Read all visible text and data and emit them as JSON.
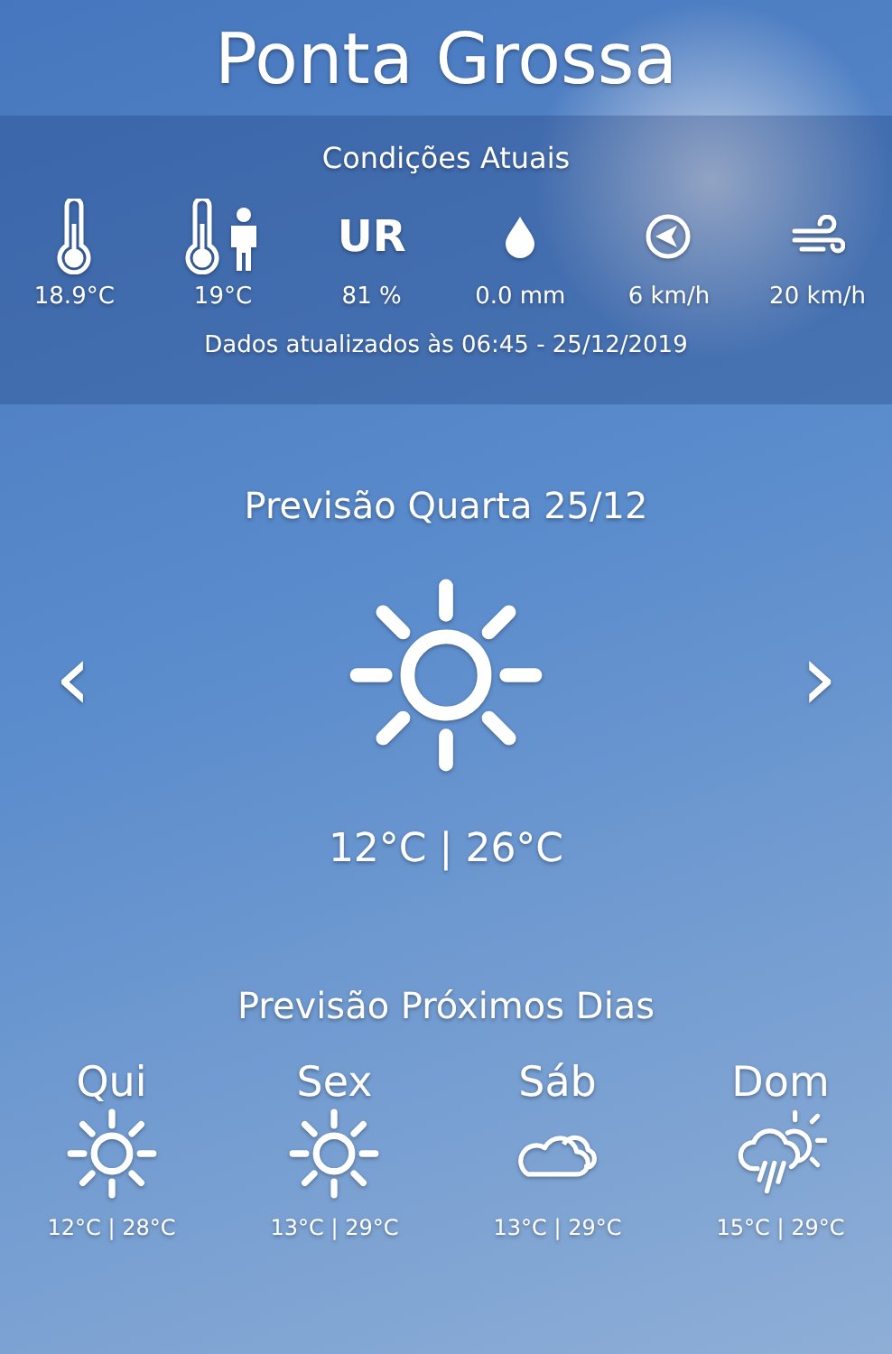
{
  "city": "Ponta Grossa",
  "current": {
    "title": "Condições Atuais",
    "items": [
      {
        "kind": "temperature",
        "value": "18.9°C"
      },
      {
        "kind": "feels-like",
        "value": "19°C"
      },
      {
        "kind": "humidity",
        "label": "UR",
        "value": "81 %"
      },
      {
        "kind": "rain",
        "value": "0.0 mm"
      },
      {
        "kind": "wind-direction",
        "value": "6 km/h"
      },
      {
        "kind": "wind-gust",
        "value": "20 km/h"
      }
    ],
    "updated": "Dados atualizados às 06:45 - 25/12/2019"
  },
  "today": {
    "title": "Previsão Quarta 25/12",
    "prev": "‹",
    "next": "›",
    "kind": "sun",
    "temps": "12°C | 26°C"
  },
  "next_days": {
    "title": "Previsão Próximos Dias",
    "days": [
      {
        "day": "Qui",
        "kind": "sun",
        "temps": "12°C | 28°C"
      },
      {
        "day": "Sex",
        "kind": "sun",
        "temps": "13°C | 29°C"
      },
      {
        "day": "Sáb",
        "kind": "cloud",
        "temps": "13°C | 29°C"
      },
      {
        "day": "Dom",
        "kind": "rain-sun",
        "temps": "15°C | 29°C"
      }
    ]
  }
}
